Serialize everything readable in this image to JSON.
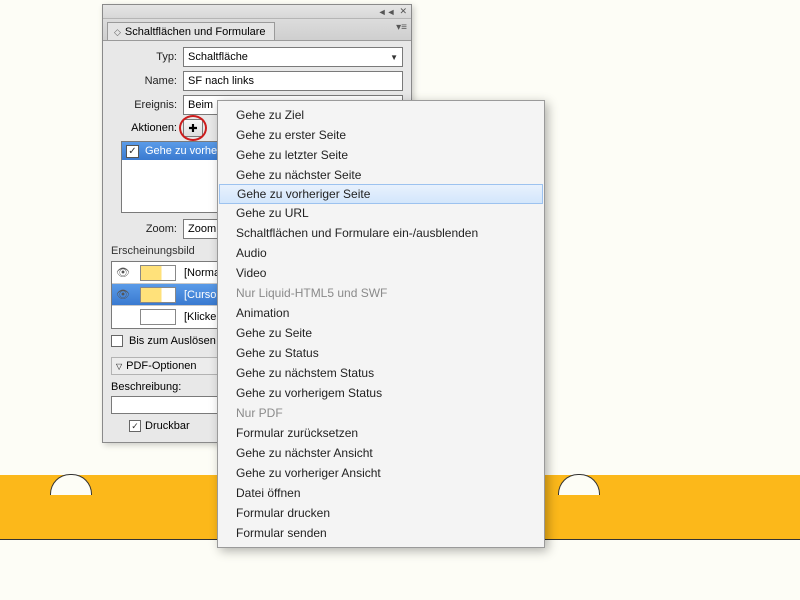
{
  "panel": {
    "title": "Schaltflächen und Formulare",
    "typ_label": "Typ:",
    "typ_value": "Schaltfläche",
    "name_label": "Name:",
    "name_value": "SF nach links",
    "ereignis_label": "Ereignis:",
    "ereignis_value": "Beim Loslassen oder Antippen",
    "aktionen_label": "Aktionen:",
    "add_glyph": "✚",
    "action_item": "Gehe zu vorheriger Seite",
    "zoom_label": "Zoom:",
    "zoom_value": "Zoom ü",
    "appearance_label": "Erscheinungsbild",
    "states": [
      {
        "eye": "👁",
        "has_thumb": true,
        "label": "[Normal]",
        "sel": false
      },
      {
        "eye": "👁",
        "has_thumb": true,
        "label": "[Cursor darüber]",
        "sel": true
      },
      {
        "eye": "",
        "has_thumb": false,
        "label": "[Klicken]",
        "sel": false
      }
    ],
    "bis_ausloesen": "Bis zum Auslösen ausblenden",
    "pdf_optionen": "PDF-Optionen",
    "beschreibung": "Beschreibung:",
    "druckbar": "Druckbar"
  },
  "menu": {
    "items1": [
      "Gehe zu Ziel",
      "Gehe zu erster Seite",
      "Gehe zu letzter Seite",
      "Gehe zu nächster Seite",
      "Gehe zu vorheriger Seite",
      "Gehe zu URL",
      "Schaltflächen und Formulare ein-/ausblenden",
      "Audio",
      "Video"
    ],
    "header1": "Nur Liquid-HTML5 und SWF",
    "items2": [
      "Animation",
      "Gehe zu Seite",
      "Gehe zu Status",
      "Gehe zu nächstem Status",
      "Gehe zu vorherigem Status"
    ],
    "header2": "Nur PDF",
    "items3": [
      "Formular zurücksetzen",
      "Gehe zu nächster Ansicht",
      "Gehe zu vorheriger Ansicht",
      "Datei öffnen",
      "Formular drucken",
      "Formular senden"
    ],
    "highlighted": "Gehe zu vorheriger Seite"
  }
}
